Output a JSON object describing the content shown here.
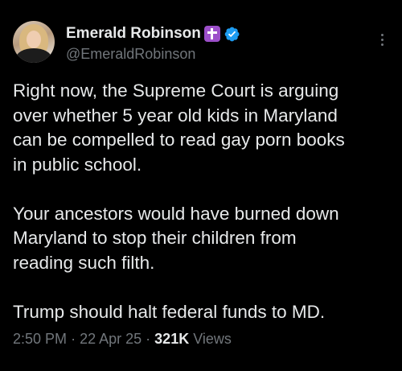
{
  "author": {
    "display_name": "Emerald Robinson",
    "handle": "@EmeraldRobinson",
    "avatar_icon": "profile-photo",
    "badges": [
      "latin-cross-emoji",
      "verified-checkmark"
    ],
    "verified_color": "#1d9bf0",
    "cross_badge_color": "#9c4fc9"
  },
  "tweet": {
    "paragraphs": [
      "Right now, the Supreme Court is arguing\nover whether 5 year old kids in Maryland\ncan be compelled to read gay porn books\nin public school.",
      "Your ancestors would have burned down\nMaryland to stop their children from\nreading such filth.",
      "Trump should halt federal funds to MD."
    ]
  },
  "meta": {
    "time": "2:50 PM",
    "separator": "·",
    "date": "22 Apr 25",
    "views_count": "321K",
    "views_label": "Views"
  },
  "theme": {
    "background": "#000000",
    "primary_text": "#e7e9ea",
    "secondary_text": "#71767b"
  }
}
